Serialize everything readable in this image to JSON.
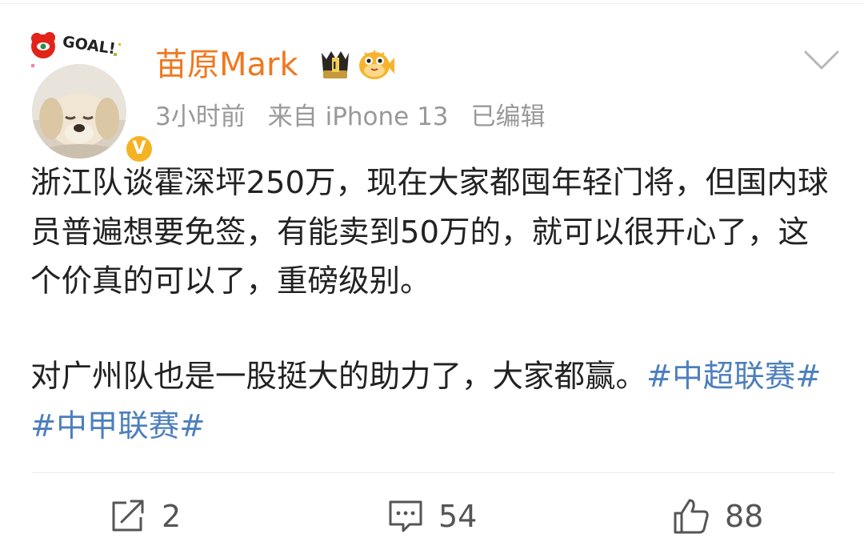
{
  "post": {
    "author": {
      "name": "苗原Mark",
      "badge_text": "GOAL!",
      "verified_symbol": "V"
    },
    "meta": {
      "time": "3小时前",
      "source": "来自 iPhone 13",
      "edited": "已编辑"
    },
    "body": {
      "paragraph1": "浙江队谈霍深坪250万，现在大家都囤年轻门将，但国内球员普遍想要免签，有能卖到50万的，就可以很开心了，这个价真的可以了，重磅级别。",
      "paragraph2_text": "对广州队也是一股挺大的助力了，大家都赢。",
      "hashtags": [
        "#中超联赛#",
        "#中甲联赛#"
      ]
    },
    "actions": {
      "repost_count": "2",
      "comment_count": "54",
      "like_count": "88"
    }
  },
  "colors": {
    "username": "#f0781e",
    "hashtag": "#4d7fbd",
    "meta": "#999999",
    "verified": "#f5b324"
  },
  "icons": [
    "goal-badge-icon",
    "verified-icon",
    "medal-icon",
    "fish-icon",
    "chevron-down-icon",
    "repost-icon",
    "comment-icon",
    "like-icon"
  ]
}
